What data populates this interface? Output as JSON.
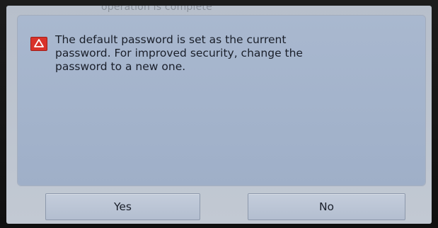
{
  "background": {
    "obscured_text": "operation is complete"
  },
  "dialog": {
    "icon": "warning-triangle-icon",
    "icon_color": "#d9322a",
    "message_lines": [
      "The default password is set as the current",
      "password. For improved security, change the",
      "password to a new one."
    ]
  },
  "buttons": {
    "yes_label": "Yes",
    "no_label": "No"
  }
}
